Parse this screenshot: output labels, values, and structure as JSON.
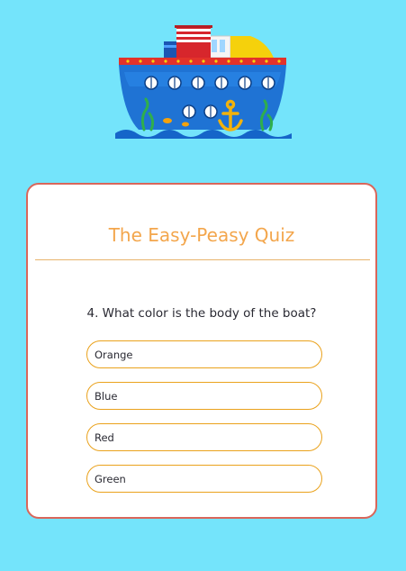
{
  "illustration": {
    "name": "boat-illustration",
    "colors": {
      "hull": "#1f73d4",
      "hull_stripe": "#e3322a",
      "deck": "#f5d10c",
      "funnel_red": "#d7262c",
      "anchor": "#f2b20c",
      "seaweed": "#2fae4d"
    }
  },
  "quiz": {
    "title": "The Easy-Peasy Quiz",
    "question": "4. What color is the body of the boat?",
    "options": [
      {
        "label": "Orange"
      },
      {
        "label": "Blue"
      },
      {
        "label": "Red"
      },
      {
        "label": "Green"
      }
    ]
  },
  "theme": {
    "page_background": "#74e4fb",
    "card_border": "#d9665a",
    "title_color": "#f3a64c",
    "option_border": "#eaa21c"
  }
}
